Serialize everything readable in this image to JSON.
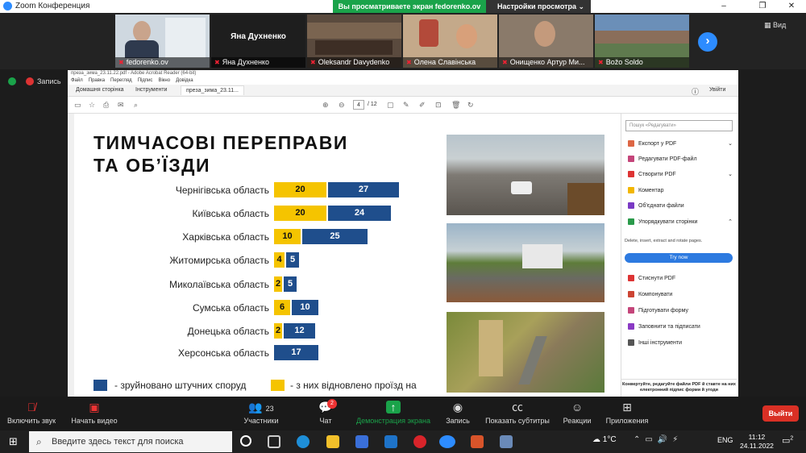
{
  "window": {
    "title": "Zoom Конференция",
    "controls": [
      "–",
      "❐",
      "✕"
    ]
  },
  "share_banner": {
    "viewing_text": "Вы просматриваете экран fedorenko.ov",
    "options_label": "Настройки просмотра"
  },
  "gallery": {
    "participants": [
      {
        "name": "fedorenko.ov",
        "muted": true
      },
      {
        "name": "Яна Духненко",
        "muted": true,
        "display_name": "Яна Духненко"
      },
      {
        "name": "Oleksandr Davydenko",
        "muted": true
      },
      {
        "name": "Олена Славінська",
        "muted": true
      },
      {
        "name": "Онищенко Артур Ми...",
        "muted": true
      },
      {
        "name": "Božo Soldo",
        "muted": true
      }
    ],
    "view_label": "Вид"
  },
  "recording": {
    "label": "Запись"
  },
  "acrobat": {
    "title_bar": "преза_зима_23.11.22.pdf - Adobe Acrobat Reader (64-bit)",
    "menu": [
      "Файл",
      "Правка",
      "Перегляд",
      "Підпис",
      "Вікно",
      "Довідка"
    ],
    "tabs": [
      "Домашня сторінка",
      "Інструменти",
      "преза_зима_23.11..."
    ],
    "page_current": "4",
    "page_total": "/ 12",
    "sign_in": "Увійти"
  },
  "slide": {
    "title_line1": "ТИМЧАСОВІ ПЕРЕПРАВИ",
    "title_line2": "ТА ОБ’ЇЗДИ",
    "legend_blue": "- зруйновано штучних споруд",
    "legend_yellow": "- з них відновлено проїзд на"
  },
  "chart_data": {
    "type": "bar",
    "categories": [
      "Чернігівська область",
      "Київська область",
      "Харківська область",
      "Житомирська область",
      "Миколаївська область",
      "Сумська область",
      "Донецька область",
      "Херсонська область"
    ],
    "series": [
      {
        "name": "- з них відновлено проїзд на",
        "color": "#f5c400",
        "values": [
          20,
          20,
          10,
          4,
          2,
          6,
          2,
          null
        ]
      },
      {
        "name": "- зруйновано штучних споруд",
        "color": "#1f4e8c",
        "values": [
          27,
          24,
          25,
          5,
          5,
          10,
          12,
          17
        ]
      }
    ],
    "stacked": true,
    "orientation": "horizontal"
  },
  "panel": {
    "search_placeholder": "Пошук «Редагувати»",
    "items": [
      "Експорт у PDF",
      "Редагувати PDF-файл",
      "Створити PDF",
      "Коментар",
      "Об'єднати файли",
      "Упорядкувати сторінки"
    ],
    "items2": [
      "Стиснути PDF",
      "Компонувати",
      "Підготувати форму",
      "Заповнити та підписати",
      "Інші інструменти"
    ],
    "desc": "Delete, insert, extract and rotate pages.",
    "try_now": "Try now",
    "footer": "Конвертуйте, редагуйте файли PDF й ставте на них електронний підпис форми й угоди"
  },
  "toolbar": {
    "mute": "Включить звук",
    "video": "Начать видео",
    "participants": "Участники",
    "participants_count": "23",
    "chat": "Чат",
    "chat_badge": "2",
    "share": "Демонстрация экрана",
    "record": "Запись",
    "subtitles": "Показать субтитры",
    "reactions": "Реакции",
    "apps": "Приложения",
    "leave": "Выйти"
  },
  "taskbar": {
    "search_placeholder": "Введите здесь текст для поиска",
    "weather": "1°C",
    "lang": "ENG",
    "time": "11:12",
    "date": "24.11.2022",
    "notif": "2"
  }
}
